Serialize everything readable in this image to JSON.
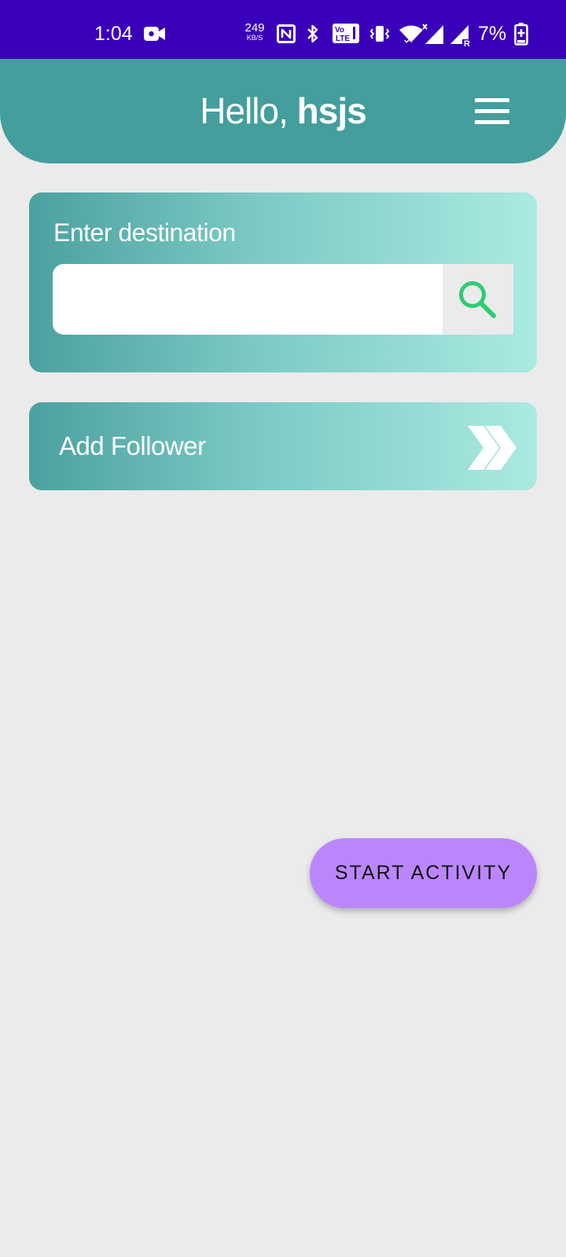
{
  "status_bar": {
    "time": "1:04",
    "net_speed_value": "249",
    "net_speed_unit": "KB/S",
    "battery_percent": "7%",
    "volte_label_top": "Vo",
    "volte_label_bottom": "LTE",
    "roaming_label": "R",
    "icons": [
      "video-camera-icon",
      "nfc-icon",
      "bluetooth-icon",
      "volte-icon",
      "vibrate-icon",
      "wifi-icon",
      "signal-icon",
      "signal-roaming-icon",
      "battery-charging-icon"
    ],
    "background_color": "#3a00b9"
  },
  "header": {
    "greeting_prefix": "Hello,",
    "user_name": "hsjs",
    "menu_icon": "hamburger-menu-icon",
    "background_color": "#439e9d"
  },
  "destination": {
    "label": "Enter destination",
    "input_value": "",
    "search_icon": "search-icon",
    "search_icon_color": "#2ecc71"
  },
  "follower": {
    "label": "Add Follower",
    "chevron_icon": "double-chevron-right-icon"
  },
  "start_button": {
    "label": "START ACTIVITY",
    "color": "#bb86fc"
  },
  "theme": {
    "page_background": "#ebebeb",
    "card_gradient_start": "#4aa19f",
    "card_gradient_end": "#aaeae1"
  }
}
